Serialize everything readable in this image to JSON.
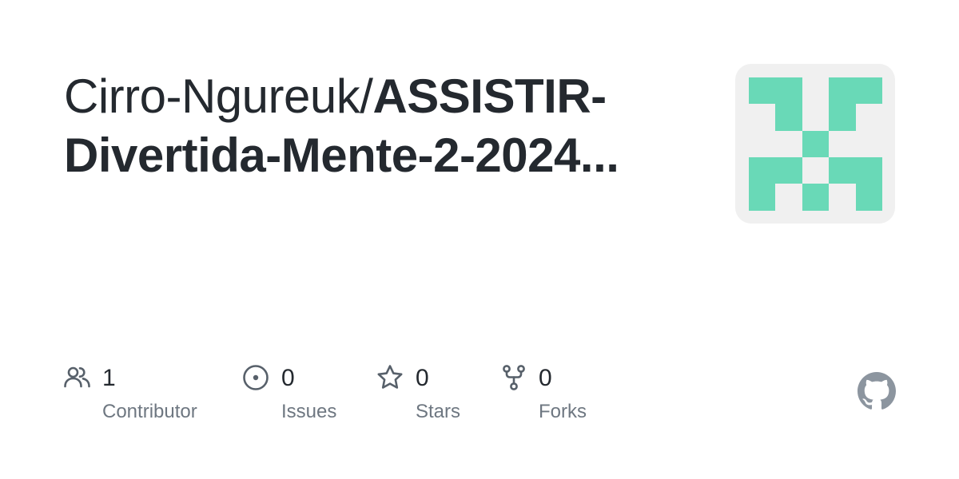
{
  "repo": {
    "owner": "Cirro-Ngureuk/",
    "name": "ASSISTIR-Divertida-Mente-2-2024..."
  },
  "avatar": {
    "icon": "identicon",
    "color": "#69d9b7",
    "background": "#f0f0f0"
  },
  "stats": [
    {
      "icon": "people-icon",
      "count": "1",
      "label": "Contributor"
    },
    {
      "icon": "issue-opened-icon",
      "count": "0",
      "label": "Issues"
    },
    {
      "icon": "star-icon",
      "count": "0",
      "label": "Stars"
    },
    {
      "icon": "repo-forked-icon",
      "count": "0",
      "label": "Forks"
    }
  ],
  "brand": {
    "icon": "github-mark-icon",
    "color": "#8c959f"
  },
  "colors": {
    "text": "#24292f",
    "muted": "#6e7781",
    "icon": "#57606a"
  }
}
